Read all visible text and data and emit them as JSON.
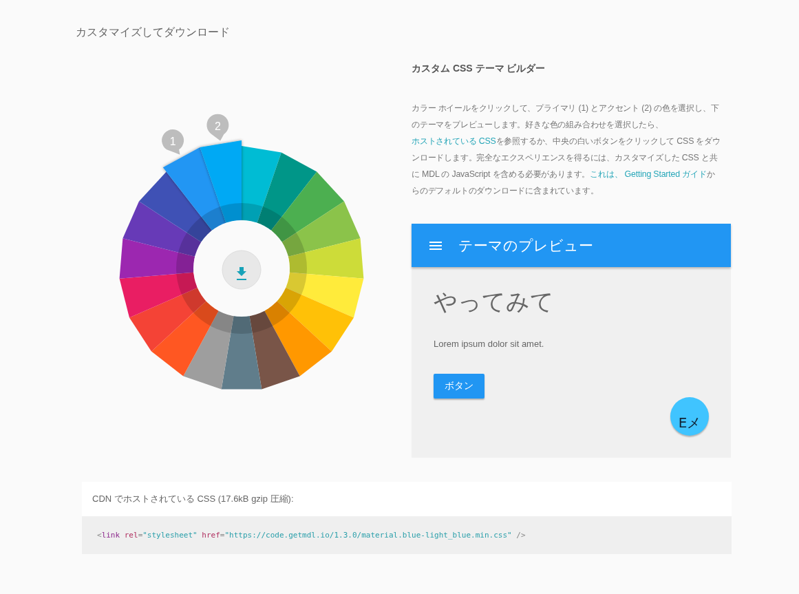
{
  "page_title": "カスタマイズしてダウンロード",
  "wheel": {
    "segments": [
      {
        "color": "#00bcd4",
        "selected": false
      },
      {
        "color": "#009688",
        "selected": false
      },
      {
        "color": "#4caf50",
        "selected": false
      },
      {
        "color": "#8bc34a",
        "selected": false
      },
      {
        "color": "#cddc39",
        "selected": false
      },
      {
        "color": "#ffeb3b",
        "selected": false
      },
      {
        "color": "#ffc107",
        "selected": false
      },
      {
        "color": "#ff9800",
        "selected": false
      },
      {
        "color": "#795548",
        "selected": false
      },
      {
        "color": "#607d8b",
        "selected": false
      },
      {
        "color": "#9e9e9e",
        "selected": false
      },
      {
        "color": "#ff5722",
        "selected": false
      },
      {
        "color": "#f44336",
        "selected": false
      },
      {
        "color": "#e91e63",
        "selected": false
      },
      {
        "color": "#9c27b0",
        "selected": false
      },
      {
        "color": "#673ab7",
        "selected": false
      },
      {
        "color": "#3f51b5",
        "selected": false
      },
      {
        "color": "#2196f3",
        "selected": true,
        "marker": "1"
      },
      {
        "color": "#03a9f4",
        "selected": true,
        "marker": "2"
      }
    ]
  },
  "builder": {
    "title": "カスタム CSS テーマ ビルダー",
    "description": [
      {
        "text": "カラー ホイールをクリックして、プライマリ (1) とアクセント (2) の色を選択し、下のテーマをプレビューします。好きな色の組み合わせを選択したら、",
        "link": false
      },
      {
        "text": "ホストされている CSS",
        "link": true
      },
      {
        "text": "を参照するか、中央の白いボタンをクリックして CSS をダウンロードします。完全なエクスペリエンスを得るには、カスタマイズした CSS と共に MDL の JavaScript を含める必要があります。",
        "link": false
      },
      {
        "text": "これは、 Getting Started ガイド",
        "link": true
      },
      {
        "text": "からのデフォルトのダウンロードに含まれています。",
        "link": false
      }
    ]
  },
  "preview": {
    "title": "テーマのプレビュー",
    "heading": "やってみて",
    "body": "Lorem ipsum dolor sit amet.",
    "button": "ボタン",
    "fab": "Eメ"
  },
  "cdn": {
    "label": "CDN でホストされている CSS (17.6kB gzip 圧縮):",
    "code": [
      {
        "kind": "punct",
        "text": "<"
      },
      {
        "kind": "tag",
        "text": "link"
      },
      {
        "kind": "attr",
        "text": " rel"
      },
      {
        "kind": "punct",
        "text": "="
      },
      {
        "kind": "string",
        "text": "\"stylesheet\""
      },
      {
        "kind": "attr",
        "text": " href"
      },
      {
        "kind": "punct",
        "text": "="
      },
      {
        "kind": "string",
        "text": "\"https://code.getmdl.io/1.3.0/material.blue-light_blue.min.css\""
      },
      {
        "kind": "punct",
        "text": " />"
      }
    ]
  }
}
